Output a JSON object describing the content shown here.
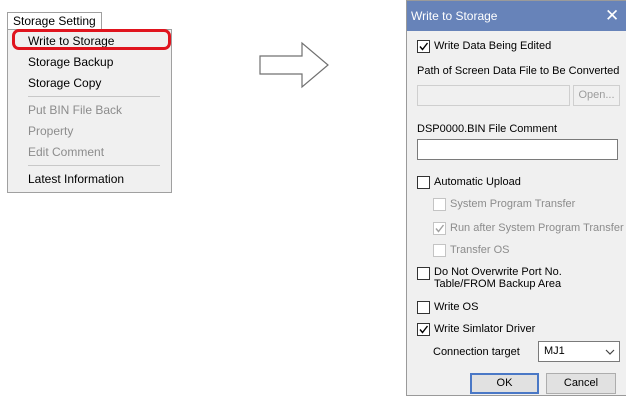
{
  "menu": {
    "tab_label": "Storage Setting",
    "items": [
      {
        "label": "Write to Storage",
        "enabled": true,
        "highlighted": true
      },
      {
        "label": "Storage Backup",
        "enabled": true
      },
      {
        "label": "Storage Copy",
        "enabled": true
      },
      {
        "label": "Put BIN File Back",
        "enabled": false
      },
      {
        "label": "Property",
        "enabled": false
      },
      {
        "label": "Edit Comment",
        "enabled": false
      },
      {
        "label": "Latest Information",
        "enabled": true
      }
    ],
    "highlight_color": "#e0141e"
  },
  "dialog": {
    "title": "Write to Storage",
    "title_bar_color": "#6783b9",
    "close_icon": "close-icon",
    "write_data_being_edited": {
      "label": "Write Data Being Edited",
      "checked": true
    },
    "path_label": "Path of Screen Data File to Be Converted",
    "path_value": "",
    "open_button": "Open...",
    "comment_label": "DSP0000.BIN File Comment",
    "comment_value": "",
    "automatic_upload": {
      "label": "Automatic Upload",
      "checked": false
    },
    "system_program_transfer": {
      "label": "System Program Transfer",
      "checked": false,
      "enabled": false
    },
    "run_after_transfer": {
      "label": "Run after System Program Transfer",
      "checked": true,
      "enabled": false
    },
    "transfer_os": {
      "label": "Transfer OS",
      "checked": false,
      "enabled": false
    },
    "do_not_overwrite": {
      "label_line1": "Do Not Overwrite Port No.",
      "label_line2": "Table/FROM Backup Area",
      "checked": false
    },
    "write_os": {
      "label": "Write OS",
      "checked": false
    },
    "write_simulator_driver": {
      "label": "Write Simlator Driver",
      "checked": true
    },
    "connection_target_label": "Connection target",
    "connection_target_value": "MJ1",
    "ok_button": "OK",
    "cancel_button": "Cancel"
  }
}
